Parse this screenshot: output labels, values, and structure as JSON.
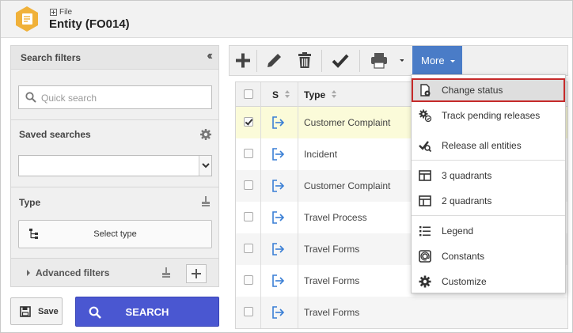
{
  "header": {
    "breadcrumb": "File",
    "title": "Entity (FO014)"
  },
  "filters": {
    "title": "Search filters",
    "quick_search_placeholder": "Quick search",
    "saved_searches_label": "Saved searches",
    "saved_searches_value": "",
    "type_label": "Type",
    "select_type_label": "Select type",
    "advanced_filters_label": "Advanced filters",
    "save_label": "Save",
    "search_label": "SEARCH"
  },
  "toolbar": {
    "more_label": "More"
  },
  "grid": {
    "columns": [
      "S",
      "Type"
    ],
    "rows": [
      {
        "type": "Customer Complaint",
        "checked": true
      },
      {
        "type": "Incident",
        "checked": false
      },
      {
        "type": "Customer Complaint",
        "checked": false
      },
      {
        "type": "Travel Process",
        "checked": false
      },
      {
        "type": "Travel Forms",
        "checked": false
      },
      {
        "type": "Travel Forms",
        "checked": false
      },
      {
        "type": "Travel Forms",
        "checked": false
      }
    ]
  },
  "more_menu": {
    "items": [
      {
        "label": "Change status",
        "icon": "change-status-icon"
      },
      {
        "label": "Track pending releases",
        "icon": "gears-icon"
      },
      {
        "label": "Release all entities",
        "icon": "release-icon"
      },
      {
        "label": "3 quadrants",
        "icon": "three-quadrants-icon"
      },
      {
        "label": "2 quadrants",
        "icon": "two-quadrants-icon"
      },
      {
        "label": "Legend",
        "icon": "legend-icon"
      },
      {
        "label": "Constants",
        "icon": "constants-icon"
      },
      {
        "label": "Customize",
        "icon": "gear-icon"
      }
    ]
  },
  "colors": {
    "accent": "#4a57d1",
    "more_button": "#4a7cc7",
    "highlight_border": "#c62a2a",
    "selected_row": "#fbfbd9"
  }
}
